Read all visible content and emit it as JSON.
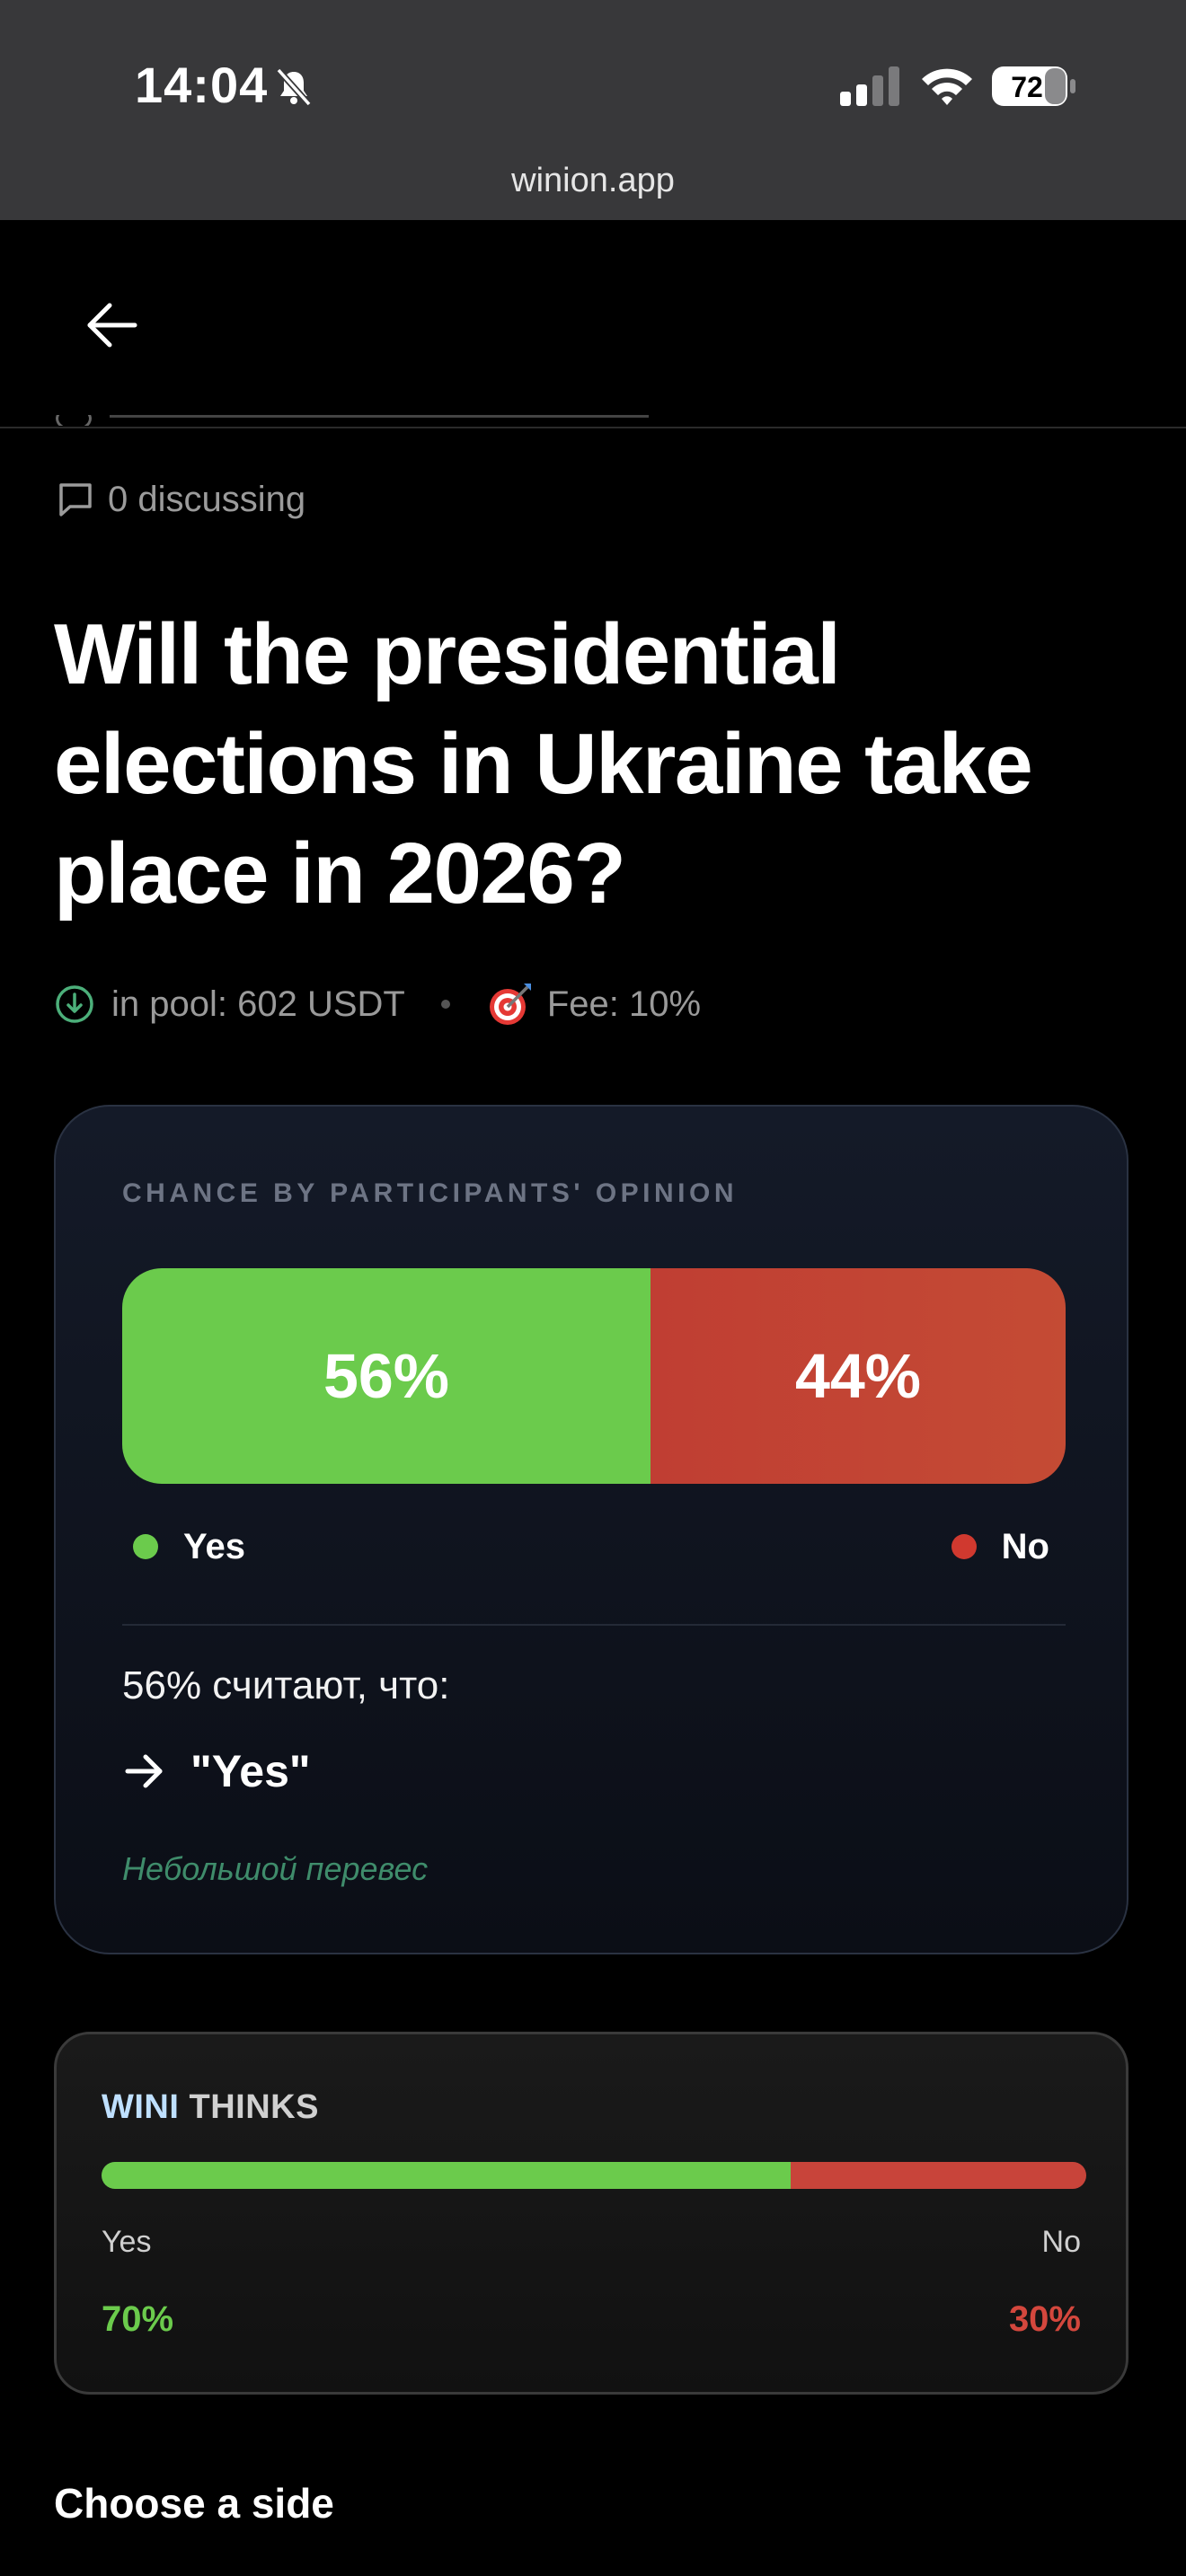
{
  "status_bar": {
    "time": "14:04",
    "battery": "72"
  },
  "browser": {
    "url": "winion.app"
  },
  "market": {
    "discussing": "0 discussing",
    "title": "Will the presidential elections in Ukraine take place in 2026?",
    "pool": "in pool: 602 USDT",
    "fee": "Fee: 10%"
  },
  "opinion": {
    "label": "CHANCE BY PARTICIPANTS' OPINION",
    "yes_percent": 56,
    "no_percent": 44,
    "yes_text": "56%",
    "no_text": "44%",
    "yes_label": "Yes",
    "no_label": "No",
    "count_text": "56% считают, что:",
    "verdict": "\"Yes\"",
    "note": "Небольшой перевес",
    "colors": {
      "yes": "#6bcb4c",
      "no": "#c24436"
    }
  },
  "wini": {
    "title_accent": "WINI",
    "title_rest": " THINKS",
    "yes_percent": 70,
    "no_percent": 30,
    "yes_label": "Yes",
    "no_label": "No",
    "yes_text": "70%",
    "no_text": "30%"
  },
  "choose_side": "Choose a side"
}
